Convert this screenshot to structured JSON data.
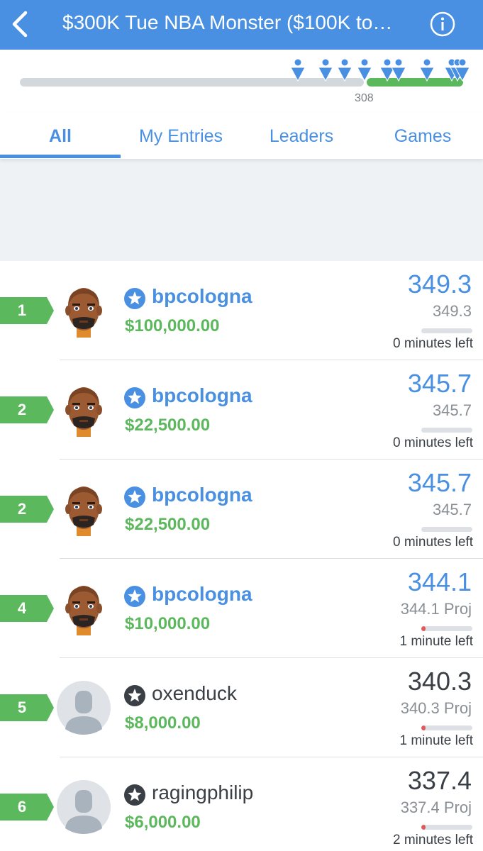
{
  "header": {
    "title": "$300K Tue NBA Monster ($100K to…"
  },
  "payout_bar": {
    "place_label": "308"
  },
  "tabs": [
    {
      "label": "All",
      "active": true
    },
    {
      "label": "My Entries",
      "active": false
    },
    {
      "label": "Leaders",
      "active": false
    },
    {
      "label": "Games",
      "active": false
    }
  ],
  "colors": {
    "accent": "#4a90e2",
    "prize_green": "#5cb85c",
    "rank_green": "#5cb85c"
  },
  "entries": [
    {
      "rank": "1",
      "username": "bpcologna",
      "mine": true,
      "prize": "$100,000.00",
      "score": "349.3",
      "subscore": "349.3",
      "progress": 0,
      "time_left": "0 minutes left",
      "avatar": "mii-avatar"
    },
    {
      "rank": "2",
      "username": "bpcologna",
      "mine": true,
      "prize": "$22,500.00",
      "score": "345.7",
      "subscore": "345.7",
      "progress": 0,
      "time_left": "0 minutes left",
      "avatar": "mii-avatar"
    },
    {
      "rank": "2",
      "username": "bpcologna",
      "mine": true,
      "prize": "$22,500.00",
      "score": "345.7",
      "subscore": "345.7",
      "progress": 0,
      "time_left": "0 minutes left",
      "avatar": "mii-avatar"
    },
    {
      "rank": "4",
      "username": "bpcologna",
      "mine": true,
      "prize": "$10,000.00",
      "score": "344.1",
      "subscore": "344.1 Proj",
      "progress": 0.08,
      "time_left": "1 minute left",
      "avatar": "mii-avatar"
    },
    {
      "rank": "5",
      "username": "oxenduck",
      "mine": false,
      "prize": "$8,000.00",
      "score": "340.3",
      "subscore": "340.3 Proj",
      "progress": 0.08,
      "time_left": "1 minute left",
      "avatar": "default-avatar"
    },
    {
      "rank": "6",
      "username": "ragingphilip",
      "mine": false,
      "prize": "$6,000.00",
      "score": "337.4",
      "subscore": "337.4 Proj",
      "progress": 0.08,
      "time_left": "2 minutes left",
      "avatar": "default-avatar"
    }
  ]
}
